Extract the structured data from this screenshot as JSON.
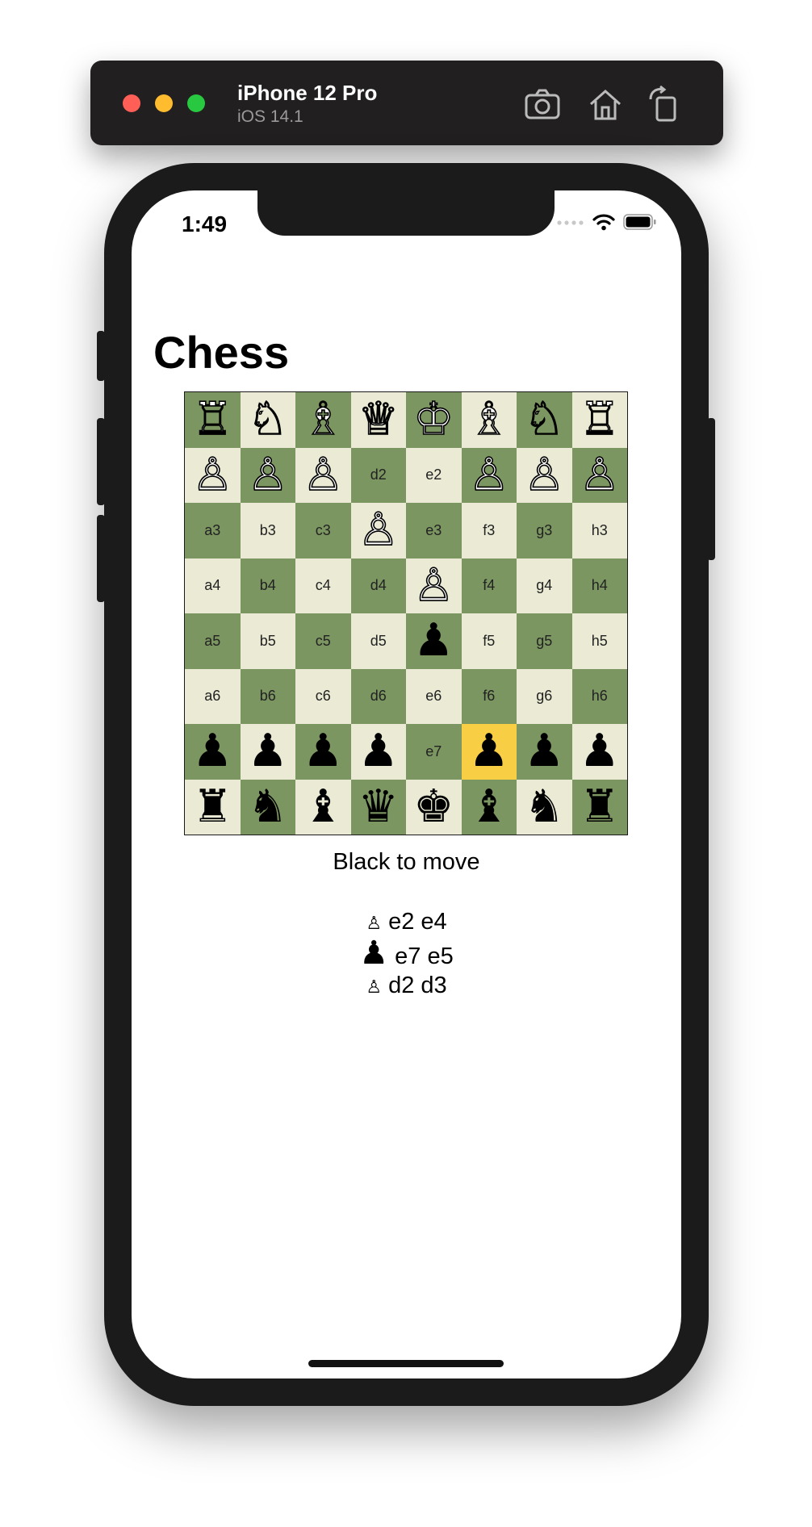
{
  "simulator": {
    "device_name": "iPhone 12 Pro",
    "os_version": "iOS 14.1",
    "icons": [
      "screenshot-icon",
      "home-icon",
      "rotate-icon"
    ]
  },
  "status_bar": {
    "time": "1:49",
    "icons": [
      "cellular-signal-icon",
      "wifi-icon",
      "battery-icon"
    ]
  },
  "app": {
    "title": "Chess"
  },
  "board": {
    "highlight_color": "#f8cf44",
    "light_color": "#ebebd5",
    "dark_color": "#7b9660",
    "rows": [
      [
        [
          "♖",
          "w"
        ],
        [
          "♘",
          "w"
        ],
        [
          "♗",
          "w"
        ],
        [
          "♕",
          "w"
        ],
        [
          "♔",
          "w"
        ],
        [
          "♗",
          "w"
        ],
        [
          "♘",
          "w"
        ],
        [
          "♖",
          "w"
        ]
      ],
      [
        [
          "♙",
          "w"
        ],
        [
          "♙",
          "w"
        ],
        [
          "♙",
          "w"
        ],
        [
          "d2",
          ""
        ],
        [
          "e2",
          ""
        ],
        [
          "♙",
          "w"
        ],
        [
          "♙",
          "w"
        ],
        [
          "♙",
          "w"
        ]
      ],
      [
        [
          "a3",
          ""
        ],
        [
          "b3",
          ""
        ],
        [
          "c3",
          ""
        ],
        [
          "♙",
          "w"
        ],
        [
          "e3",
          ""
        ],
        [
          "f3",
          ""
        ],
        [
          "g3",
          ""
        ],
        [
          "h3",
          ""
        ]
      ],
      [
        [
          "a4",
          ""
        ],
        [
          "b4",
          ""
        ],
        [
          "c4",
          ""
        ],
        [
          "d4",
          ""
        ],
        [
          "♙",
          "w"
        ],
        [
          "f4",
          ""
        ],
        [
          "g4",
          ""
        ],
        [
          "h4",
          ""
        ]
      ],
      [
        [
          "a5",
          ""
        ],
        [
          "b5",
          ""
        ],
        [
          "c5",
          ""
        ],
        [
          "d5",
          ""
        ],
        [
          "♟",
          "b"
        ],
        [
          "f5",
          ""
        ],
        [
          "g5",
          ""
        ],
        [
          "h5",
          ""
        ]
      ],
      [
        [
          "a6",
          ""
        ],
        [
          "b6",
          ""
        ],
        [
          "c6",
          ""
        ],
        [
          "d6",
          ""
        ],
        [
          "e6",
          ""
        ],
        [
          "f6",
          ""
        ],
        [
          "g6",
          ""
        ],
        [
          "h6",
          ""
        ]
      ],
      [
        [
          "♟",
          "b"
        ],
        [
          "♟",
          "b"
        ],
        [
          "♟",
          "b"
        ],
        [
          "♟",
          "b"
        ],
        [
          "e7",
          ""
        ],
        [
          "♟",
          "b"
        ],
        [
          "♟",
          "b"
        ],
        [
          "♟",
          "b"
        ]
      ],
      [
        [
          "♜",
          "b"
        ],
        [
          "♞",
          "b"
        ],
        [
          "♝",
          "b"
        ],
        [
          "♛",
          "b"
        ],
        [
          "♚",
          "b"
        ],
        [
          "♝",
          "b"
        ],
        [
          "♞",
          "b"
        ],
        [
          "♜",
          "b"
        ]
      ]
    ],
    "highlighted": [
      [
        6,
        5
      ]
    ]
  },
  "turn_status": "Black to move",
  "moves": [
    {
      "glyph": "♙",
      "text": "e2 e4"
    },
    {
      "glyph": "♟",
      "text": "e7 e5"
    },
    {
      "glyph": "♙",
      "text": "d2 d3"
    }
  ]
}
